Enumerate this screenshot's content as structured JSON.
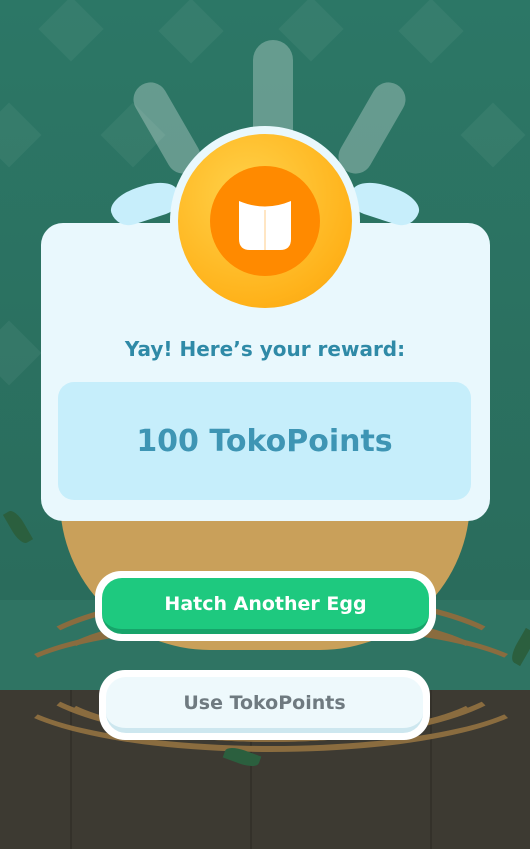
{
  "reward": {
    "message": "Yay! Here’s your reward:",
    "points_label": "100 TokoPoints"
  },
  "buttons": {
    "primary_label": "Hatch Another Egg",
    "secondary_label": "Use TokoPoints"
  },
  "colors": {
    "accent_green": "#1ec97f",
    "card_bg": "#e9f8fd",
    "points_bg": "#c6eefb",
    "coin_orange": "#ff8a00",
    "coin_gold": "#ffb21a",
    "text_blue": "#2f8aa7"
  },
  "icons": {
    "coin": "tokopedia-coin-icon"
  }
}
